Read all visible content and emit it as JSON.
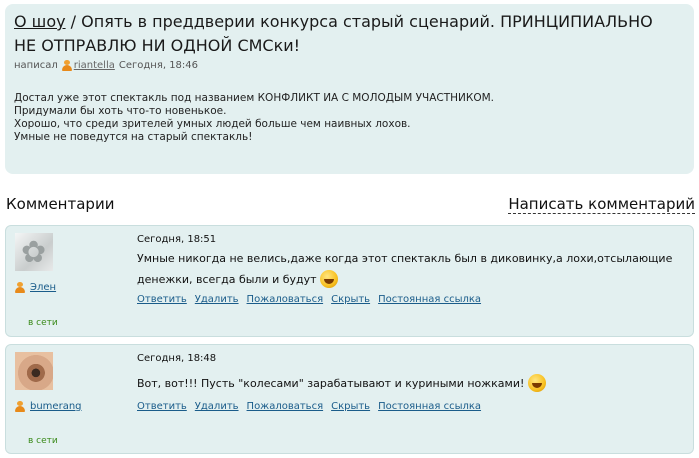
{
  "post": {
    "show_link": "О шоу",
    "title_rest": " / Опять в преддверии конкурса старый сценарий. ПРИНЦИПИАЛЬНО НЕ ОТПРАВЛЮ НИ ОДНОЙ СМСки!",
    "byline_prefix": "написал",
    "author": "riantella",
    "time": "Сегодня, 18:46",
    "body": [
      "Достал уже этот спектакль под названием КОНФЛИКТ ИА С МОЛОДЫМ УЧАСТНИКОМ.",
      "Придумали бы хоть что-то новенькое.",
      "Хорошо, что среди зрителей умных людей больше чем наивных лохов.",
      "Умные не поведутся на старый спектакль!"
    ]
  },
  "comments_header": "Комментарии",
  "write_comment": "Написать комментарий",
  "actions": [
    "Ответить",
    "Удалить",
    "Пожаловаться",
    "Скрыть",
    "Постоянная ссылка"
  ],
  "comments": [
    {
      "author": "Элен",
      "status": "в сети",
      "time": "Сегодня, 18:51",
      "text": "Умные никогда не велись,даже когда этот спектакль был в диковинку,а лохи,отсылающие денежки, всегда были и будут"
    },
    {
      "author": "bumerang",
      "status": "в сети",
      "time": "Сегодня, 18:48",
      "text": "Вот, вот!!! Пусть \"колесами\" зарабатывают и куриными ножками!"
    }
  ]
}
